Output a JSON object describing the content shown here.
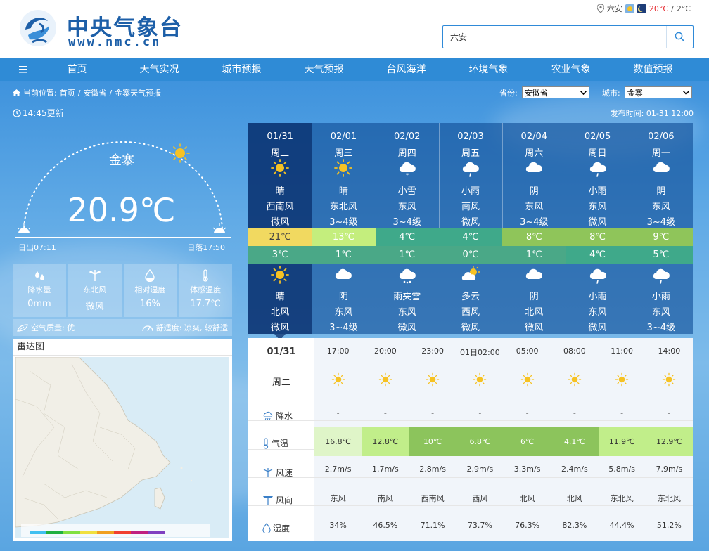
{
  "site": {
    "name": "中央气象台",
    "url": "www.nmc.cn"
  },
  "topbar": {
    "location": "六安",
    "temp_high": "20°C",
    "separator": "/",
    "temp_low": "2°C"
  },
  "search": {
    "value": "六安"
  },
  "nav": {
    "items": [
      "首页",
      "天气实况",
      "城市预报",
      "天气预报",
      "台风海洋",
      "环境气象",
      "农业气象",
      "数值预报"
    ]
  },
  "breadcrumb": {
    "label": "当前位置:",
    "items": [
      "首页",
      "安徽省",
      "金寨天气预报"
    ],
    "sep": "/"
  },
  "selectors": {
    "province_label": "省份:",
    "province_value": "安徽省",
    "city_label": "城市:",
    "city_value": "金寨"
  },
  "update_time": "14:45更新",
  "publish_time": "发布时间: 01-31 12:00",
  "current": {
    "city": "金寨",
    "temperature": "20.9℃",
    "sunrise": "日出07:11",
    "sunset": "日落17:50",
    "stats": [
      {
        "label": "降水量",
        "value": "0mm",
        "icon": "raindrops-icon"
      },
      {
        "label": "东北风",
        "value": "微风",
        "icon": "wind-turbine-icon"
      },
      {
        "label": "相对湿度",
        "value": "16%",
        "icon": "water-drop-icon"
      },
      {
        "label": "体感温度",
        "value": "17.7℃",
        "icon": "thermometer-icon"
      }
    ],
    "air_quality": "空气质量: 优",
    "comfort": "舒适度: 凉爽, 较舒适"
  },
  "radar": {
    "title": "雷达图"
  },
  "days": [
    {
      "date": "01/31",
      "week": "周二",
      "icon1": "sun",
      "w1": "晴",
      "dir1": "西南风",
      "pow1": "微风",
      "high": "21℃",
      "low": "3℃",
      "icon2": "sun",
      "w2": "晴",
      "dir2": "北风",
      "pow2": "微风",
      "high_color": "#f1d960",
      "low_color": "#4aa887"
    },
    {
      "date": "02/01",
      "week": "周三",
      "icon1": "sun",
      "w1": "晴",
      "dir1": "东北风",
      "pow1": "3~4级",
      "high": "13℃",
      "low": "1℃",
      "icon2": "cloud",
      "w2": "阴",
      "dir2": "东风",
      "pow2": "3~4级",
      "high_color": "#c4ee7d",
      "low_color": "#4aa887"
    },
    {
      "date": "02/02",
      "week": "周四",
      "icon1": "snow",
      "w1": "小雪",
      "dir1": "东风",
      "pow1": "3~4级",
      "high": "4℃",
      "low": "1℃",
      "icon2": "sleet",
      "w2": "雨夹雪",
      "dir2": "东风",
      "pow2": "微风",
      "high_color": "#3fa98a",
      "low_color": "#4aa887"
    },
    {
      "date": "02/03",
      "week": "周五",
      "icon1": "rain",
      "w1": "小雨",
      "dir1": "南风",
      "pow1": "微风",
      "high": "4℃",
      "low": "0℃",
      "icon2": "partly",
      "w2": "多云",
      "dir2": "西风",
      "pow2": "微风",
      "high_color": "#3fa98a",
      "low_color": "#4aa887"
    },
    {
      "date": "02/04",
      "week": "周六",
      "icon1": "cloud",
      "w1": "阴",
      "dir1": "东风",
      "pow1": "3~4级",
      "high": "8℃",
      "low": "1℃",
      "icon2": "cloud",
      "w2": "阴",
      "dir2": "北风",
      "pow2": "微风",
      "high_color": "#8fc55a",
      "low_color": "#4aa887"
    },
    {
      "date": "02/05",
      "week": "周日",
      "icon1": "rain",
      "w1": "小雨",
      "dir1": "东风",
      "pow1": "微风",
      "high": "8℃",
      "low": "4℃",
      "icon2": "rain",
      "w2": "小雨",
      "dir2": "东风",
      "pow2": "微风",
      "high_color": "#8fc55a",
      "low_color": "#3fa98a"
    },
    {
      "date": "02/06",
      "week": "周一",
      "icon1": "cloud",
      "w1": "阴",
      "dir1": "东风",
      "pow1": "3~4级",
      "high": "9℃",
      "low": "5℃",
      "icon2": "rain",
      "w2": "小雨",
      "dir2": "东风",
      "pow2": "3~4级",
      "high_color": "#8fc55a",
      "low_color": "#3fa98a"
    }
  ],
  "hourly": {
    "date": "01/31",
    "week": "周二",
    "labels": {
      "rain": "降水",
      "temp": "气温",
      "wind_speed": "风速",
      "wind_dir": "风向",
      "humidity": "湿度"
    },
    "cols": [
      {
        "time": "17:00",
        "rain": "-",
        "temp": "16.8℃",
        "ws": "2.7m/s",
        "wd": "东风",
        "hum": "34%",
        "color": "#dff5c8"
      },
      {
        "time": "20:00",
        "rain": "-",
        "temp": "12.8℃",
        "ws": "1.7m/s",
        "wd": "南风",
        "hum": "46.5%",
        "color": "#c1ee8a"
      },
      {
        "time": "23:00",
        "rain": "-",
        "temp": "10℃",
        "ws": "2.8m/s",
        "wd": "西南风",
        "hum": "71.1%",
        "color": "#8cc45c"
      },
      {
        "time": "01日02:00",
        "rain": "-",
        "temp": "6.8℃",
        "ws": "2.9m/s",
        "wd": "西风",
        "hum": "73.7%",
        "color": "#8cc45c"
      },
      {
        "time": "05:00",
        "rain": "-",
        "temp": "6℃",
        "ws": "3.3m/s",
        "wd": "北风",
        "hum": "76.3%",
        "color": "#8cc45c"
      },
      {
        "time": "08:00",
        "rain": "-",
        "temp": "4.1℃",
        "ws": "2.4m/s",
        "wd": "北风",
        "hum": "82.3%",
        "color": "#8cc45c"
      },
      {
        "time": "11:00",
        "rain": "-",
        "temp": "11.9℃",
        "ws": "5.8m/s",
        "wd": "东北风",
        "hum": "44.4%",
        "color": "#c1ee8a"
      },
      {
        "time": "14:00",
        "rain": "-",
        "temp": "12.9℃",
        "ws": "7.9m/s",
        "wd": "东北风",
        "hum": "51.2%",
        "color": "#c1ee8a"
      }
    ]
  },
  "colors": {
    "brand": "#1d5fa8",
    "nav": "#2f8bd6",
    "alert": "#e6262c"
  }
}
